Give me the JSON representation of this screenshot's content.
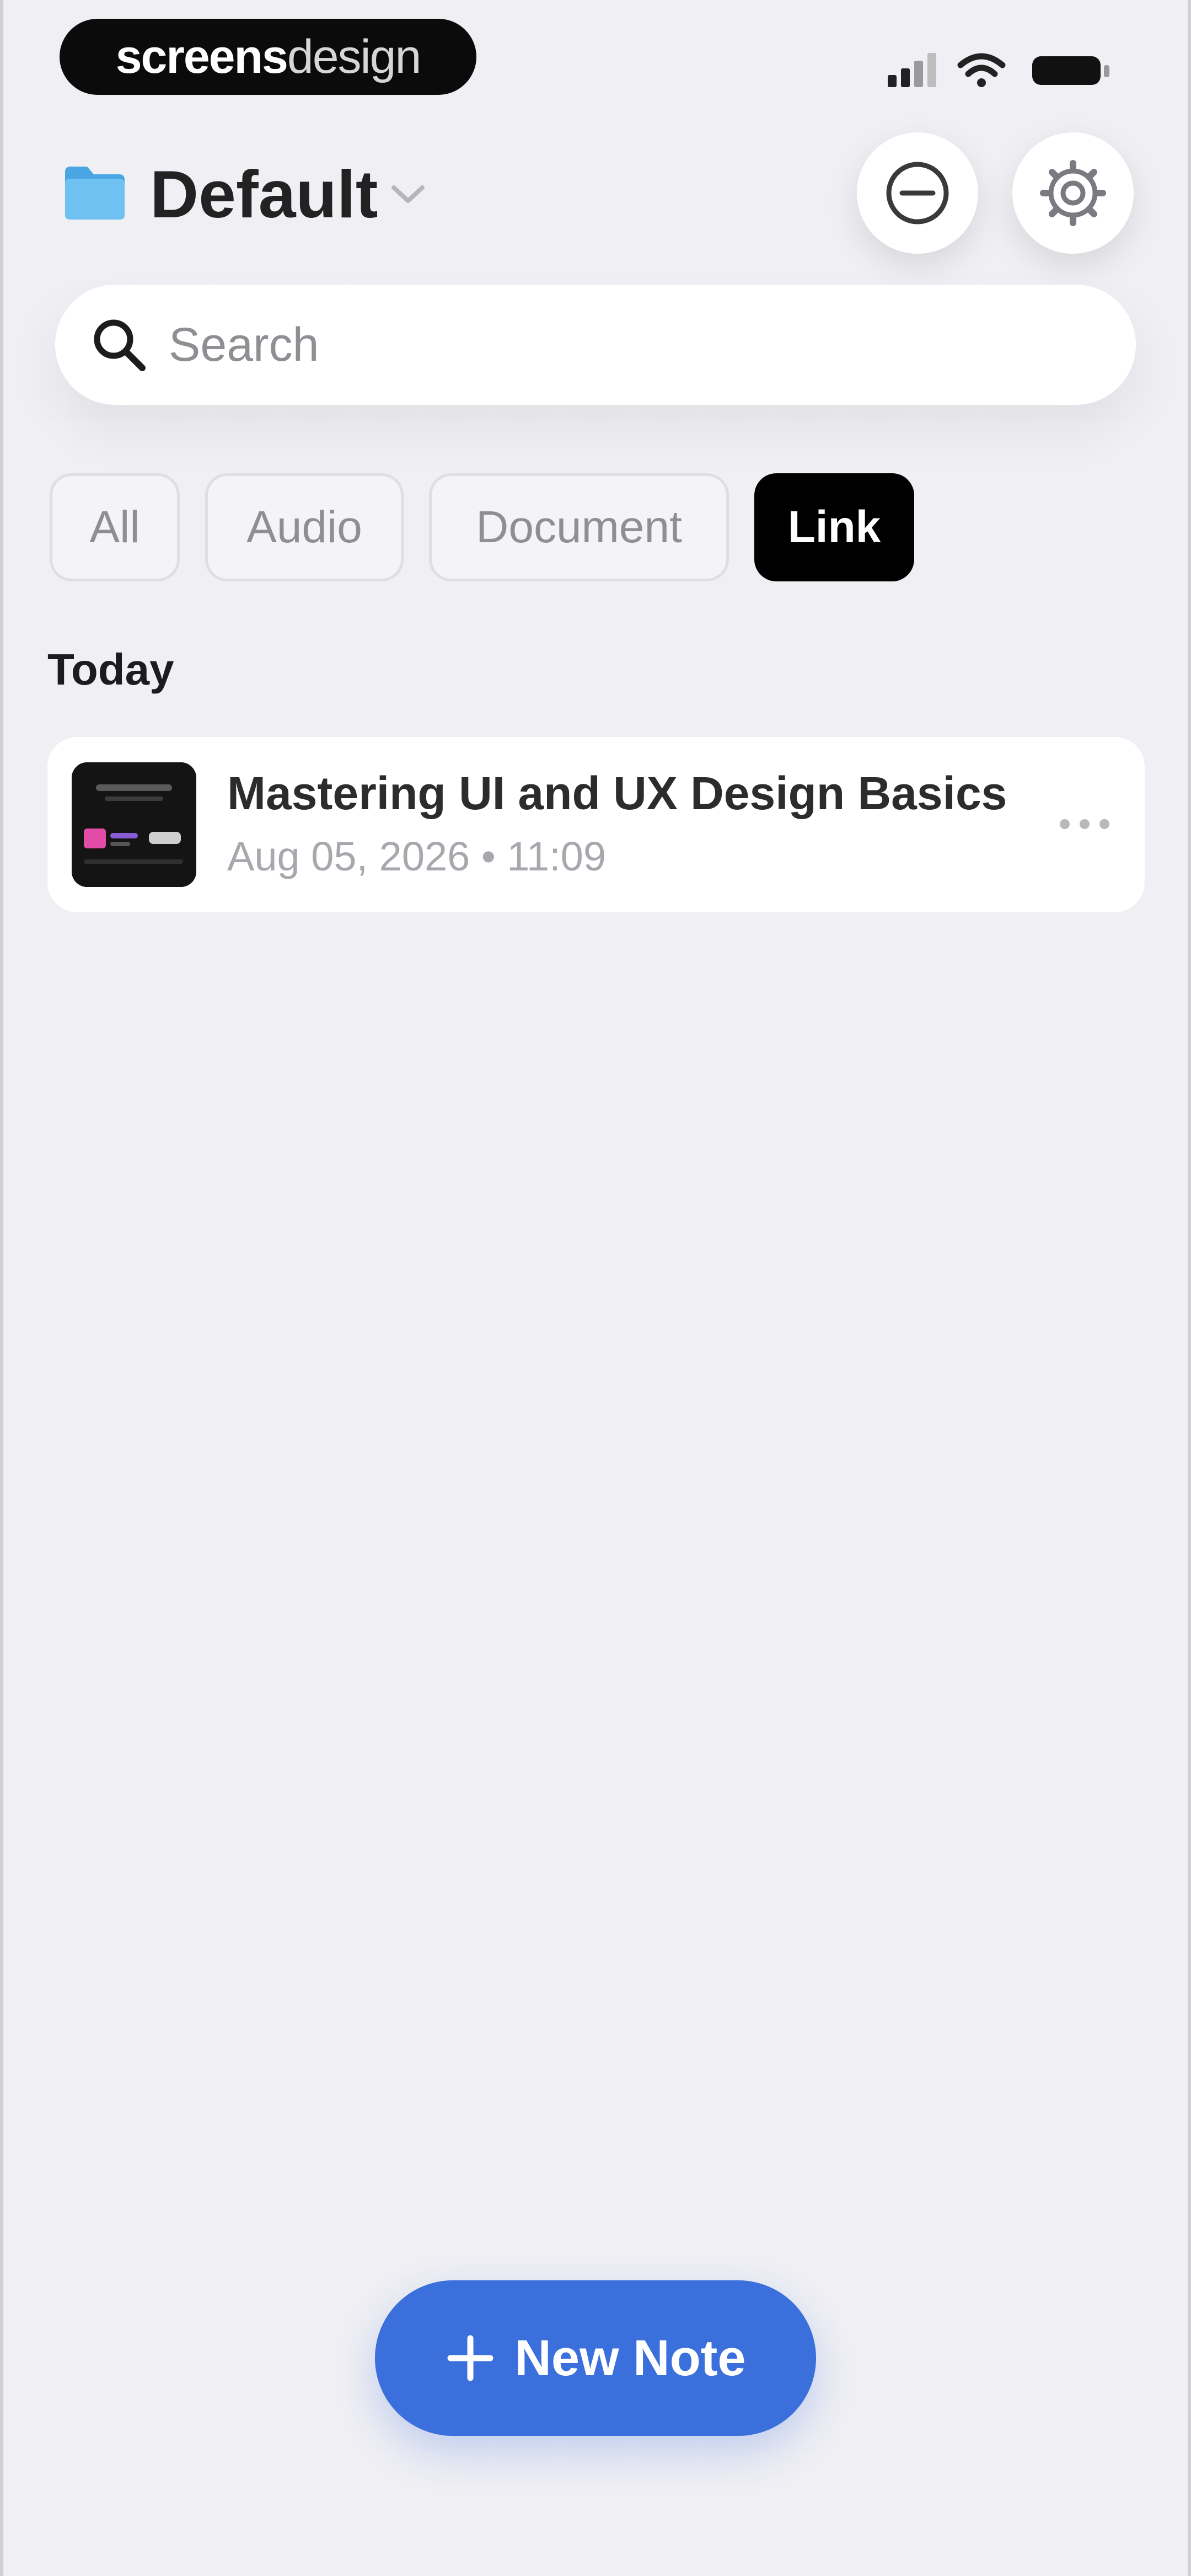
{
  "status_bar": {
    "brand_bold": "screens",
    "brand_light": "design",
    "icons": [
      "cellular-signal-icon",
      "wifi-icon",
      "battery-icon"
    ]
  },
  "header": {
    "folder_icon": "folder-icon",
    "folder_name": "Default",
    "chevron_icon": "chevron-down-icon",
    "minus_icon": "minus-circle-icon",
    "settings_icon": "gear-icon"
  },
  "search": {
    "icon": "search-icon",
    "placeholder": "Search",
    "value": ""
  },
  "filters": {
    "items": [
      "All",
      "Audio",
      "Document",
      "Link"
    ],
    "selected": "Link"
  },
  "sections": [
    {
      "label": "Today",
      "notes": [
        {
          "title": "Mastering UI and UX Design Basics",
          "meta": "Aug 05, 2026 • 11:09",
          "more_icon": "more-horizontal-icon"
        }
      ]
    }
  ],
  "new_note": {
    "label": "New Note",
    "icon": "plus-icon"
  },
  "colors": {
    "background": "#efeff4",
    "accent": "#3a6fdc",
    "folder": "#5db3ea",
    "active_chip": "#000000"
  }
}
